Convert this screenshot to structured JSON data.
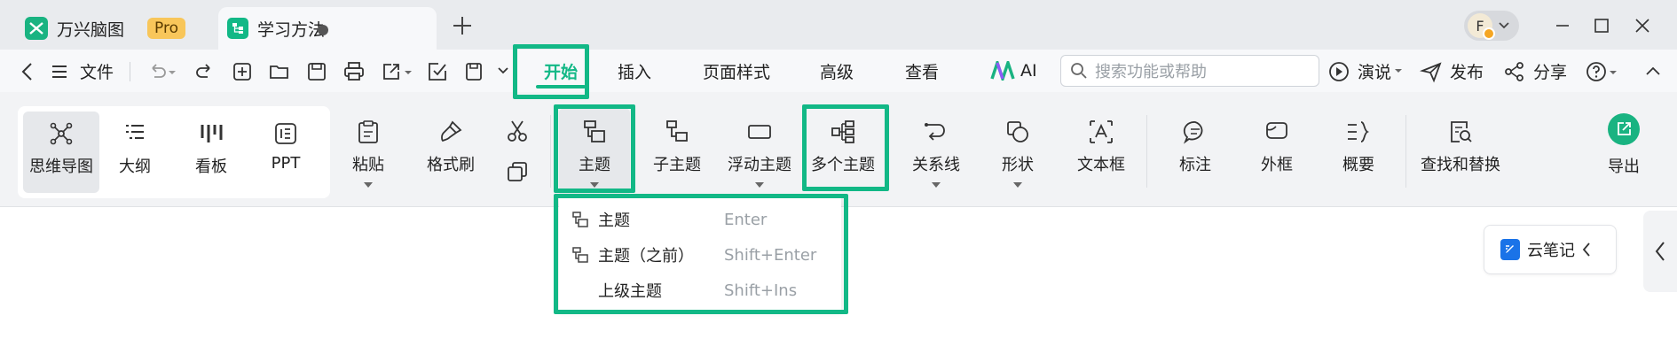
{
  "app": {
    "home_tab_label": "万兴脑图",
    "pro_badge": "Pro",
    "doc_tab_label": "学习方法",
    "avatar_letter": "F"
  },
  "menubar": {
    "file": "文件",
    "tabs": [
      "开始",
      "插入",
      "页面样式",
      "高级",
      "查看",
      "AI"
    ],
    "active_tab": "开始",
    "search_placeholder": "搜索功能或帮助",
    "present": "演说",
    "publish": "发布",
    "share": "分享"
  },
  "ribbon": {
    "views": [
      "思维导图",
      "大纲",
      "看板",
      "PPT"
    ],
    "paste": "粘贴",
    "format_painter": "格式刷",
    "topic": "主题",
    "subtopic": "子主题",
    "floating_topic": "浮动主题",
    "multi_topic": "多个主题",
    "relationship": "关系线",
    "shape": "形状",
    "textbox": "文本框",
    "callout": "标注",
    "boundary": "外框",
    "summary": "概要",
    "find_replace": "查找和替换",
    "export": "导出"
  },
  "dropdown": {
    "items": [
      {
        "label": "主题",
        "shortcut": "Enter"
      },
      {
        "label": "主题（之前）",
        "shortcut": "Shift+Enter"
      },
      {
        "label": "上级主题",
        "shortcut": "Shift+Ins"
      }
    ]
  },
  "side_panel": {
    "cloud_note": "云笔记"
  },
  "colors": {
    "accent_green": "#12b886",
    "brand_green": "#19b381",
    "pro_yellow": "#f8c65a",
    "cloud_blue": "#1a73e8"
  }
}
